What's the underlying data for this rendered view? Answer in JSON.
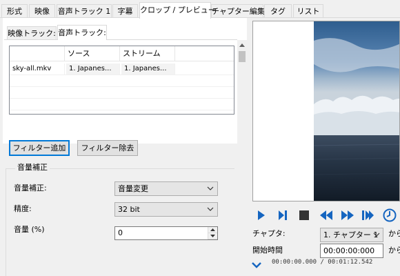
{
  "main_tabs": [
    "形式",
    "映像",
    "音声トラック 1",
    "字幕",
    "クロップ / プレビュー",
    "チャプター編集",
    "タグ",
    "リスト"
  ],
  "sub_tabs": [
    "映像トラック:",
    "音声トラック:"
  ],
  "listview": {
    "columns": [
      "",
      "ソース",
      "ストリーム"
    ],
    "rows": [
      [
        "sky-all.mkv",
        "1. Japanes...",
        "1. Japanes..."
      ]
    ]
  },
  "buttons": {
    "add_filter": "フィルター追加",
    "remove_filter": "フィルター除去"
  },
  "group": {
    "title": "音量補正",
    "volume_correction_label": "音量補正:",
    "volume_correction_value": "音量変更",
    "precision_label": "精度:",
    "precision_value": "32 bit",
    "volume_label": "音量 (%)",
    "volume_value": "0"
  },
  "right": {
    "chapter_label": "チャプタ:",
    "chapter_value": "1. チャプター 1",
    "from_label_1": "から",
    "start_time_label": "開始時間",
    "start_time_value": "00:00:00:000",
    "from_label_2": "から",
    "timecode": "00:00:00.000 / 00:01:12.542"
  },
  "colors": {
    "accent": "#0078d7",
    "control_blue": "#1565c0",
    "window_bg": "#f0f0f0"
  }
}
